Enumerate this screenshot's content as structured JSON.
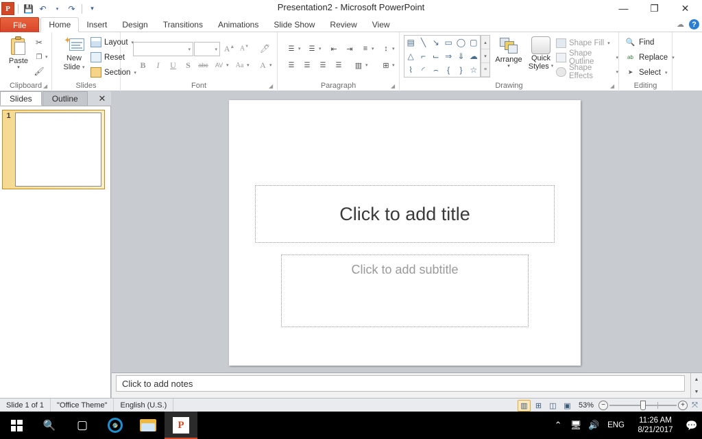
{
  "app": {
    "title": "Presentation2  -  Microsoft PowerPoint",
    "logo": "P"
  },
  "quick_access": {
    "items": [
      {
        "name": "save-icon",
        "glyph": "💾"
      },
      {
        "name": "undo-icon",
        "glyph": "↶"
      },
      {
        "name": "undo-dropdown-icon",
        "glyph": "▾"
      },
      {
        "name": "redo-icon",
        "glyph": "↷"
      },
      {
        "name": "customize-qat-icon",
        "glyph": "▾"
      }
    ]
  },
  "window_controls": {
    "minimize": "—",
    "restore": "❐",
    "close": "✕",
    "ribbon_minimize": "☁",
    "help": "?"
  },
  "tabs": [
    {
      "label": "File",
      "id": "file"
    },
    {
      "label": "Home",
      "id": "home"
    },
    {
      "label": "Insert",
      "id": "insert"
    },
    {
      "label": "Design",
      "id": "design"
    },
    {
      "label": "Transitions",
      "id": "transitions"
    },
    {
      "label": "Animations",
      "id": "animations"
    },
    {
      "label": "Slide Show",
      "id": "slide-show"
    },
    {
      "label": "Review",
      "id": "review"
    },
    {
      "label": "View",
      "id": "view"
    }
  ],
  "active_tab": "Home",
  "ribbon": {
    "clipboard": {
      "label": "Clipboard",
      "paste": "Paste",
      "paste_caret": "▾",
      "cut": "✂",
      "copy": "❐",
      "format_painter": "🖌",
      "copy_caret": "▾"
    },
    "slides": {
      "label": "Slides",
      "new_slide": "New",
      "new_slide2": "Slide",
      "new_slide_caret": "▾",
      "layout": "Layout",
      "reset": "Reset",
      "section": "Section",
      "caret": "▾"
    },
    "font": {
      "label": "Font",
      "font_name_value": "",
      "font_name_placeholder": "",
      "font_size_value": "",
      "grow_font": "A",
      "shrink_font": "A",
      "clear_formatting": "🖊",
      "bold": "B",
      "italic": "I",
      "underline": "U",
      "shadow": "S",
      "strikethrough": "abc",
      "char_spacing": "AV",
      "change_case": "Aa",
      "font_color": "A",
      "caret": "▾"
    },
    "paragraph": {
      "label": "Paragraph",
      "bullets": "☰",
      "numbering": "☰",
      "decrease_indent": "⇤",
      "increase_indent": "⇥",
      "line_spacing": "≡",
      "text_direction": "↕",
      "align_text": "⊞",
      "convert_smartart": "▦",
      "align_left": "☰",
      "align_center": "☰",
      "align_right": "☰",
      "justify": "☰",
      "columns": "▥",
      "caret": "▾"
    },
    "drawing": {
      "label": "Drawing",
      "shapes": [
        {
          "name": "text-box-shape",
          "glyph": "▤"
        },
        {
          "name": "line-shape",
          "glyph": "╲"
        },
        {
          "name": "line-arrow-shape",
          "glyph": "↘"
        },
        {
          "name": "rectangle-shape",
          "glyph": "▭"
        },
        {
          "name": "oval-shape",
          "glyph": "◯"
        },
        {
          "name": "rounded-rectangle-shape",
          "glyph": "▢"
        },
        {
          "name": "isosceles-triangle-shape",
          "glyph": "△"
        },
        {
          "name": "elbow-connector-shape",
          "glyph": "⌐"
        },
        {
          "name": "elbow-arrow-connector-shape",
          "glyph": "⌙"
        },
        {
          "name": "right-arrow-shape",
          "glyph": "⇒"
        },
        {
          "name": "down-arrow-shape",
          "glyph": "⇓"
        },
        {
          "name": "cloud-shape",
          "glyph": "☁"
        },
        {
          "name": "freeform-shape",
          "glyph": "⌇"
        },
        {
          "name": "arc-shape",
          "glyph": "◜"
        },
        {
          "name": "curve-shape",
          "glyph": "⌢"
        },
        {
          "name": "left-brace-shape",
          "glyph": "{"
        },
        {
          "name": "right-brace-shape",
          "glyph": "}"
        },
        {
          "name": "star-shape",
          "glyph": "☆"
        }
      ],
      "gallery_up": "▴",
      "gallery_down": "▾",
      "gallery_more": "≡",
      "arrange": "Arrange",
      "arrange_caret": "▾",
      "quick_styles_1": "Quick",
      "quick_styles_2": "Styles",
      "quick_caret": "▾",
      "shape_fill": "Shape Fill",
      "shape_outline": "Shape Outline",
      "shape_effects": "Shape Effects",
      "caret": "▾"
    },
    "editing": {
      "label": "Editing",
      "find": "Find",
      "find_icon": "🔍",
      "replace": "Replace",
      "replace_icon": "ab",
      "select": "Select",
      "select_icon": "➤",
      "caret": "▾"
    }
  },
  "slide_panel": {
    "tabs": [
      {
        "label": "Slides",
        "active": true
      },
      {
        "label": "Outline",
        "active": false
      }
    ],
    "close": "✕",
    "slide_number": "1"
  },
  "slide": {
    "title_placeholder": "Click to add title",
    "subtitle_placeholder": "Click to add subtitle"
  },
  "notes": {
    "placeholder": "Click to add notes",
    "scroll_up": "▲",
    "scroll_down": "▼"
  },
  "status_bar": {
    "slide_count": "Slide 1 of 1",
    "theme": "\"Office Theme\"",
    "language": "English (U.S.)",
    "zoom_level": "53%",
    "zoom_out": "−",
    "zoom_in": "+",
    "fit_to_window": "⤧",
    "views": [
      {
        "name": "normal-view-button",
        "glyph": "▥",
        "active": true
      },
      {
        "name": "slide-sorter-view-button",
        "glyph": "⊞",
        "active": false
      },
      {
        "name": "reading-view-button",
        "glyph": "◫",
        "active": false
      },
      {
        "name": "slide-show-view-button",
        "glyph": "▣",
        "active": false
      }
    ]
  },
  "taskbar": {
    "start": "start-button",
    "search": "🔍",
    "task_view": "▢",
    "ie": "e",
    "explorer": "file-explorer",
    "powerpoint": "P",
    "tray_up": "⌃",
    "tray_network": "🖥",
    "tray_volume": "🔊",
    "language": "ENG",
    "time": "11:26 AM",
    "date": "8/21/2017",
    "notifications": "💬"
  },
  "colors": {
    "accent": "#d24726",
    "workspace": "#c8ccd1",
    "ribbon_bg": "#ffffff",
    "taskbar": "#000000",
    "selection": "#f6d98f"
  }
}
